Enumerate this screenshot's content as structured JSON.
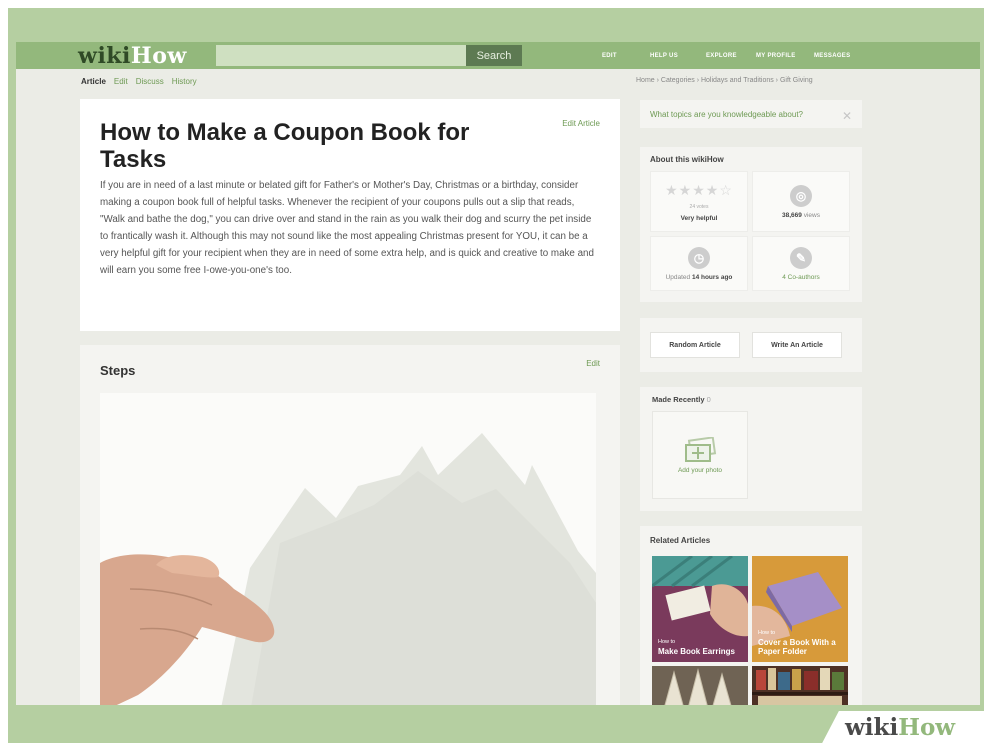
{
  "header": {
    "logo_wiki": "wiki",
    "logo_how": "How",
    "search_button": "Search",
    "nav": [
      "EDIT",
      "HELP US",
      "EXPLORE",
      "MY PROFILE",
      "MESSAGES"
    ]
  },
  "tabs": [
    "Article",
    "Edit",
    "Discuss",
    "History"
  ],
  "breadcrumb": "Home › Categories › Holidays and Traditions › Gift Giving",
  "article": {
    "title": "How to Make a Coupon Book for Tasks",
    "edit_link": "Edit Article",
    "intro": "If you are in need of a last minute or belated gift for Father's or Mother's Day, Christmas or a birthday, consider making a coupon book full of helpful tasks. Whenever the recipient of your coupons pulls out a slip that reads, \"Walk and bathe the dog,\" you can drive over and stand in the rain as you walk their dog and scurry the pet inside to frantically wash it. Although this may not sound like the most appealing Christmas present for YOU, it can be a very helpful gift for your recipient when they are in need of some extra help, and is quick and creative to make and will earn you some free I-owe-you-one's too."
  },
  "steps": {
    "title": "Steps",
    "edit_link": "Edit"
  },
  "sidebar": {
    "question": "What topics are you knowledgeable about?",
    "close_glyph": "✕",
    "about": {
      "title": "About this wikiHow",
      "votes": "24 votes",
      "rating_label": "Very helpful",
      "views_count": "38,669",
      "views_word": "views",
      "updated_prefix": "Updated",
      "updated_time": "14 hours ago",
      "coauthors": "4 Co-authors"
    },
    "random_button": "Random Article",
    "write_button": "Write An Article",
    "made_recently": {
      "title": "Made Recently",
      "count": "0",
      "add_photo": "Add your photo"
    },
    "related": {
      "title": "Related Articles",
      "items": [
        {
          "prefix": "How to",
          "title": "Make Book Earrings"
        },
        {
          "prefix": "How to",
          "title": "Cover a Book With a Paper Folder"
        }
      ]
    }
  },
  "watermark": {
    "wiki": "wiki",
    "how": "How"
  },
  "colors": {
    "brand_green": "#93b87c",
    "link_green": "#6e9a54",
    "dark_green": "#5d7a52"
  }
}
